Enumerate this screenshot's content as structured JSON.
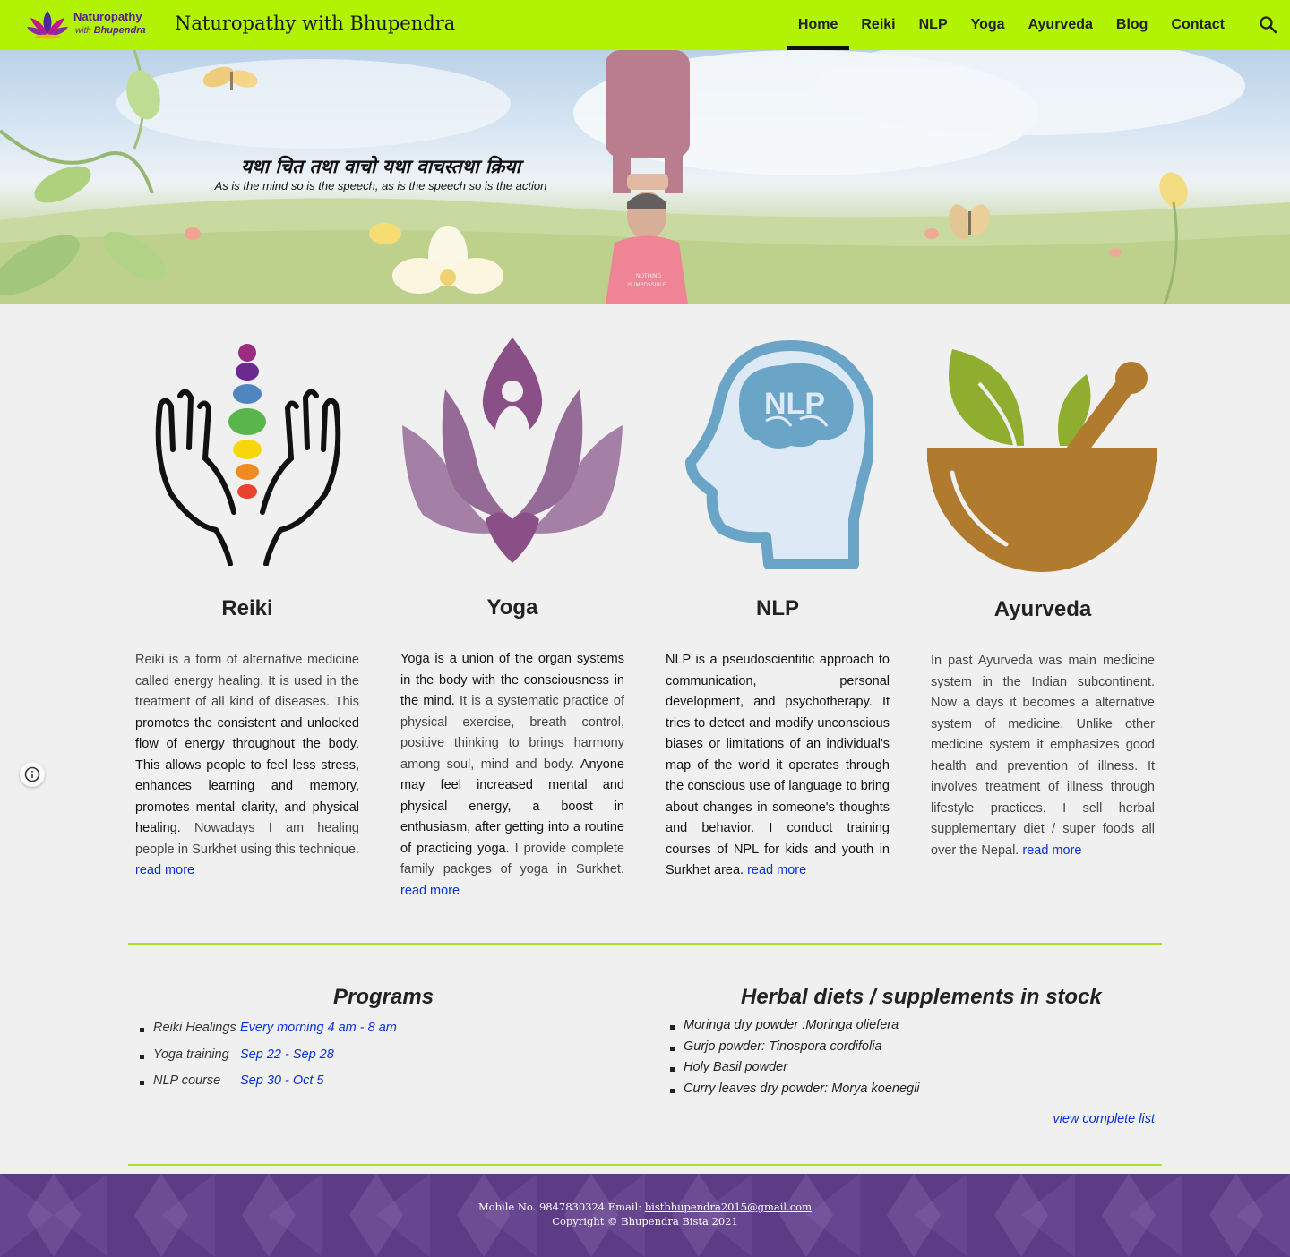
{
  "header": {
    "logo_line1": "Naturopathy",
    "logo_line2_prefix": "with",
    "logo_line2_name": "Bhupendra",
    "site_title": "Naturopathy with Bhupendra",
    "nav": [
      {
        "label": "Home",
        "active": true
      },
      {
        "label": "Reiki"
      },
      {
        "label": "NLP"
      },
      {
        "label": "Yoga"
      },
      {
        "label": "Ayurveda"
      },
      {
        "label": "Blog"
      },
      {
        "label": "Contact"
      }
    ],
    "search_icon": "search-icon",
    "accent_color": "#b2f304"
  },
  "hero": {
    "quote_hindi": "यथा चित तथा वाचो यथा वाचस्तथा क्रिया",
    "quote_english": "As is the mind so is the speech, as is the speech so is the action",
    "shirt_text_1": "NOTHING",
    "shirt_text_2": "IS IMPOSSIBLE"
  },
  "services": {
    "reiki": {
      "title": "Reiki",
      "text_a": "Reiki is a form of alternative medicine called energy healing. It is used in the treatment of all kind of diseases. This ",
      "text_b": "promotes the consistent and unlocked flow of energy throughout the body. This allows people to feel less stress, enhances learning and memory, promotes mental clarity, and physical healing.",
      "text_c": " Nowadays I am healing people in Surkhet using this technique. ",
      "link": "read more"
    },
    "yoga": {
      "title": "Yoga",
      "text_a": "Yoga is a union of the organ systems in the body with the consciousness in the mind.",
      "text_b": " It is a systematic practice of physical exercise, breath control, positive thinking to brings harmony among soul, mind and body. ",
      "text_c": "Anyone may feel increased mental and physical energy, a boost in enthusiasm, after getting into a routine of practicing yoga.",
      "text_d": "  I provide complete family packges of yoga in Surkhet. ",
      "link": "read more"
    },
    "nlp": {
      "title": "NLP",
      "icon_text": "NLP",
      "text_a": "NLP is a pseudoscientific approach to communication, personal development, and psychotherapy. It tries to detect and modify unconscious biases or limitations of an individual's map of the world it operates through the conscious use of language to bring about changes in someone's thoughts and behavior. I conduct training courses of NPL for kids and youth in Surkhet area. ",
      "link": "read more"
    },
    "ayurveda": {
      "title": "Ayurveda",
      "text_a": "In past Ayurveda was main medicine system in the Indian subcontinent. Now a days it becomes a alternative system of medicine. Unlike other medicine system it emphasizes good health and prevention of illness. It involves treatment of illness through lifestyle practices. I sell herbal supplementary diet / super foods all over the Nepal. ",
      "link": "read more"
    }
  },
  "programs": {
    "title": "Programs",
    "items": [
      {
        "name": "Reiki Healings",
        "date": "Every morning 4 am - 8 am"
      },
      {
        "name": "Yoga training",
        "date": "Sep 22 - Sep 28"
      },
      {
        "name": "NLP course",
        "date": "Sep 30 - Oct 5"
      }
    ]
  },
  "herbal": {
    "title": "Herbal diets / supplements in stock",
    "items": [
      "Moringa dry powder :Moringa oliefera",
      "Gurjo powder: Tinospora cordifolia",
      "Holy Basil powder",
      "Curry leaves dry powder: Morya koenegii"
    ],
    "view_all": "view complete list"
  },
  "footer": {
    "mobile": "Mobile No. 9847830324   Email: ",
    "email": "bistbhupendra2015@gmail.com",
    "copyright": "Copyright  ©  Bhupendra Bista 2021",
    "bg_color": "#5d3c86"
  }
}
